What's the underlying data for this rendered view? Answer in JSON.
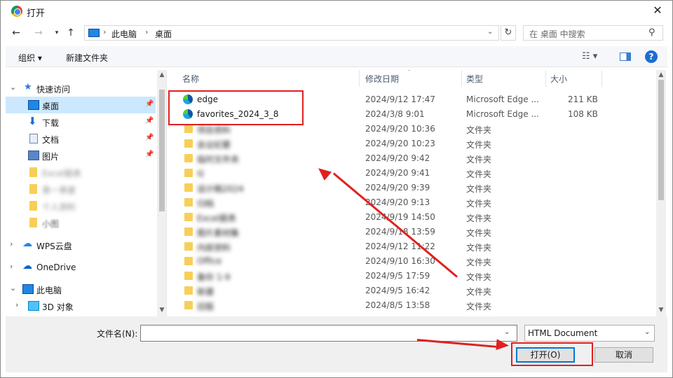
{
  "window": {
    "title": "打开",
    "close_label": "✕"
  },
  "nav": {
    "breadcrumb": [
      "此电脑",
      "桌面"
    ],
    "search_placeholder": "在 桌面 中搜索"
  },
  "toolbar": {
    "organize": "组织 ▾",
    "new_folder": "新建文件夹"
  },
  "sidebar": {
    "quick_access": "快速访问",
    "items": [
      {
        "label": "桌面",
        "pinned": true
      },
      {
        "label": "下载",
        "pinned": true
      },
      {
        "label": "文档",
        "pinned": true
      },
      {
        "label": "图片",
        "pinned": true
      },
      {
        "label": "Excel报表"
      },
      {
        "label": "第一季度"
      },
      {
        "label": "个人资料"
      },
      {
        "label": "小图"
      }
    ],
    "wps": "WPS云盘",
    "onedrive": "OneDrive",
    "this_pc": "此电脑",
    "objects_3d": "3D 对象"
  },
  "columns": {
    "name": "名称",
    "date": "修改日期",
    "type": "类型",
    "size": "大小"
  },
  "files": [
    {
      "name": "edge",
      "date": "2024/9/12 17:47",
      "type": "Microsoft Edge ...",
      "size": "211 KB",
      "icon": "edge"
    },
    {
      "name": "favorites_2024_3_8",
      "date": "2024/3/8 9:01",
      "type": "Microsoft Edge ...",
      "size": "108 KB",
      "icon": "edge"
    },
    {
      "name": "项目资料",
      "date": "2024/9/20 10:36",
      "type": "文件夹",
      "size": "",
      "icon": "folder",
      "blurred": true
    },
    {
      "name": "会议纪要",
      "date": "2024/9/20 10:23",
      "type": "文件夹",
      "size": "",
      "icon": "folder",
      "blurred": true
    },
    {
      "name": "临时文件夹",
      "date": "2024/9/20 9:42",
      "type": "文件夹",
      "size": "",
      "icon": "folder",
      "blurred": true
    },
    {
      "name": "sj",
      "date": "2024/9/20 9:41",
      "type": "文件夹",
      "size": "",
      "icon": "folder",
      "blurred": true
    },
    {
      "name": "设计稿2024",
      "date": "2024/9/20 9:39",
      "type": "文件夹",
      "size": "",
      "icon": "folder",
      "blurred": true
    },
    {
      "name": "归档",
      "date": "2024/9/20 9:13",
      "type": "文件夹",
      "size": "",
      "icon": "folder",
      "blurred": true
    },
    {
      "name": "Excel报表",
      "date": "2024/9/19 14:50",
      "type": "文件夹",
      "size": "",
      "icon": "folder",
      "blurred": true
    },
    {
      "name": "图片素材集",
      "date": "2024/9/18 13:59",
      "type": "文件夹",
      "size": "",
      "icon": "folder",
      "blurred": true
    },
    {
      "name": "内部资料",
      "date": "2024/9/12 11:22",
      "type": "文件夹",
      "size": "",
      "icon": "folder",
      "blurred": true
    },
    {
      "name": "Office",
      "date": "2024/9/10 16:30",
      "type": "文件夹",
      "size": "",
      "icon": "folder",
      "blurred": true
    },
    {
      "name": "备份 1-9",
      "date": "2024/9/5 17:59",
      "type": "文件夹",
      "size": "",
      "icon": "folder",
      "blurred": true
    },
    {
      "name": "新建",
      "date": "2024/9/5 16:42",
      "type": "文件夹",
      "size": "",
      "icon": "folder",
      "blurred": true
    },
    {
      "name": "旧版",
      "date": "2024/8/5 13:58",
      "type": "文件夹",
      "size": "",
      "icon": "folder",
      "blurred": true
    }
  ],
  "bottom": {
    "filename_label": "文件名(N):",
    "filename_value": "",
    "filetype": "HTML Document",
    "open": "打开(O)",
    "cancel": "取消"
  }
}
